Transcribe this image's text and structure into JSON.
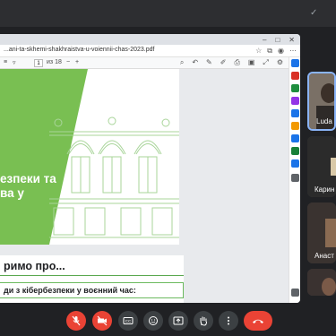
{
  "browser": {
    "url": "...ani-ta-skhemi-shakhraistva-u-voiennii-chas-2023.pdf",
    "window_controls": [
      "–",
      "□",
      "✕"
    ]
  },
  "pdf_toolbar": {
    "menu_icon": "≡",
    "page_current": "1",
    "page_total": "из 18",
    "zoom_minus": "−",
    "zoom_plus": "+"
  },
  "slide1": {
    "title_line1": "езпеки та",
    "title_line2": "ва у"
  },
  "slide2": {
    "heading": "римо про...",
    "subheading": "ди з кібербезпеки у воєнний час:"
  },
  "participants": [
    {
      "name": "Luda L"
    },
    {
      "name": "Карин"
    },
    {
      "name": "Анаст"
    },
    {
      "name": ""
    }
  ],
  "colors": {
    "accent_green": "#79bf52",
    "end_call": "#ea4335",
    "active_speaker": "#8ab4f8"
  },
  "controls": [
    {
      "icon": "mic-off-icon"
    },
    {
      "icon": "camera-off-icon"
    },
    {
      "icon": "captions-icon"
    },
    {
      "icon": "emoji-icon"
    },
    {
      "icon": "present-icon"
    },
    {
      "icon": "raise-hand-icon"
    },
    {
      "icon": "more-icon"
    },
    {
      "icon": "end-call-icon"
    }
  ]
}
